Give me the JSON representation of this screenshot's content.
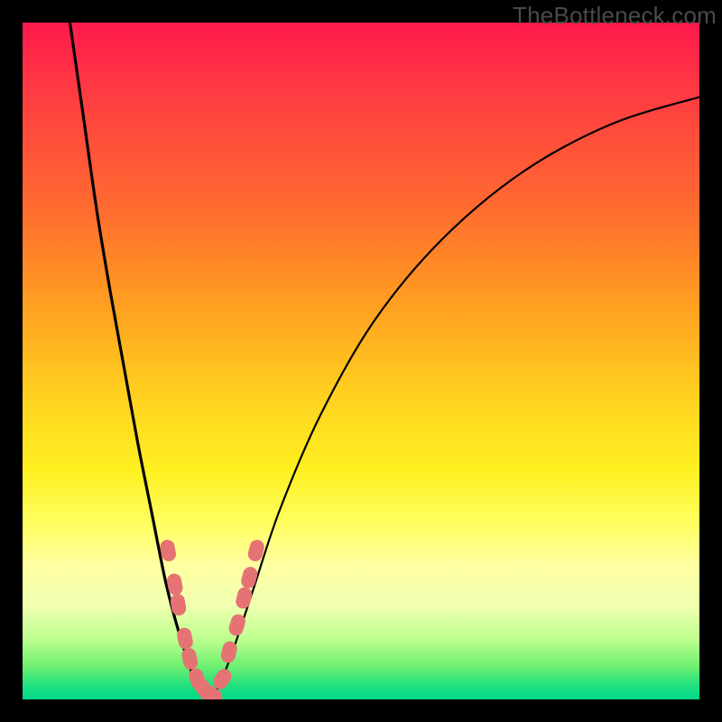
{
  "watermark": "TheBottleneck.com",
  "chart_data": {
    "type": "line",
    "title": "",
    "xlabel": "",
    "ylabel": "",
    "xlim": [
      0,
      100
    ],
    "ylim": [
      0,
      100
    ],
    "series": [
      {
        "name": "left-branch-curve",
        "x": [
          7,
          9,
          11,
          13,
          15,
          17,
          19,
          21,
          22.5,
          24,
          25,
          26,
          27
        ],
        "y": [
          100,
          86,
          72,
          60,
          49,
          38,
          28,
          18,
          12,
          7,
          4,
          2,
          0.5
        ]
      },
      {
        "name": "right-branch-curve",
        "x": [
          28,
          29,
          31,
          34,
          38,
          44,
          52,
          62,
          74,
          87,
          100
        ],
        "y": [
          0.5,
          2,
          7,
          16,
          28,
          42,
          56,
          68,
          78,
          85,
          89
        ]
      }
    ],
    "markers": [
      {
        "series": "left-branch-markers",
        "points": [
          {
            "x": 21.5,
            "y": 22
          },
          {
            "x": 22.5,
            "y": 17
          },
          {
            "x": 23.0,
            "y": 14
          },
          {
            "x": 24.0,
            "y": 9
          },
          {
            "x": 24.7,
            "y": 6
          },
          {
            "x": 25.8,
            "y": 3
          },
          {
            "x": 26.8,
            "y": 1.5
          },
          {
            "x": 28.0,
            "y": 0.7
          },
          {
            "x": 29.5,
            "y": 3
          },
          {
            "x": 30.5,
            "y": 7
          },
          {
            "x": 31.7,
            "y": 11
          },
          {
            "x": 32.7,
            "y": 15
          },
          {
            "x": 33.5,
            "y": 18
          },
          {
            "x": 34.5,
            "y": 22
          }
        ]
      }
    ],
    "colors": {
      "curve": "#000000",
      "marker_fill": "#e57373",
      "marker_stroke": "#d85a5a",
      "background_top": "#ff1a4d",
      "background_bottom": "#00d88a",
      "frame": "#000000"
    },
    "notes": "V-shaped bottleneck curve on rainbow gradient; minimum near x≈27.5, y≈0. Salmon rounded markers cluster along both branches near the bottom of the V."
  }
}
